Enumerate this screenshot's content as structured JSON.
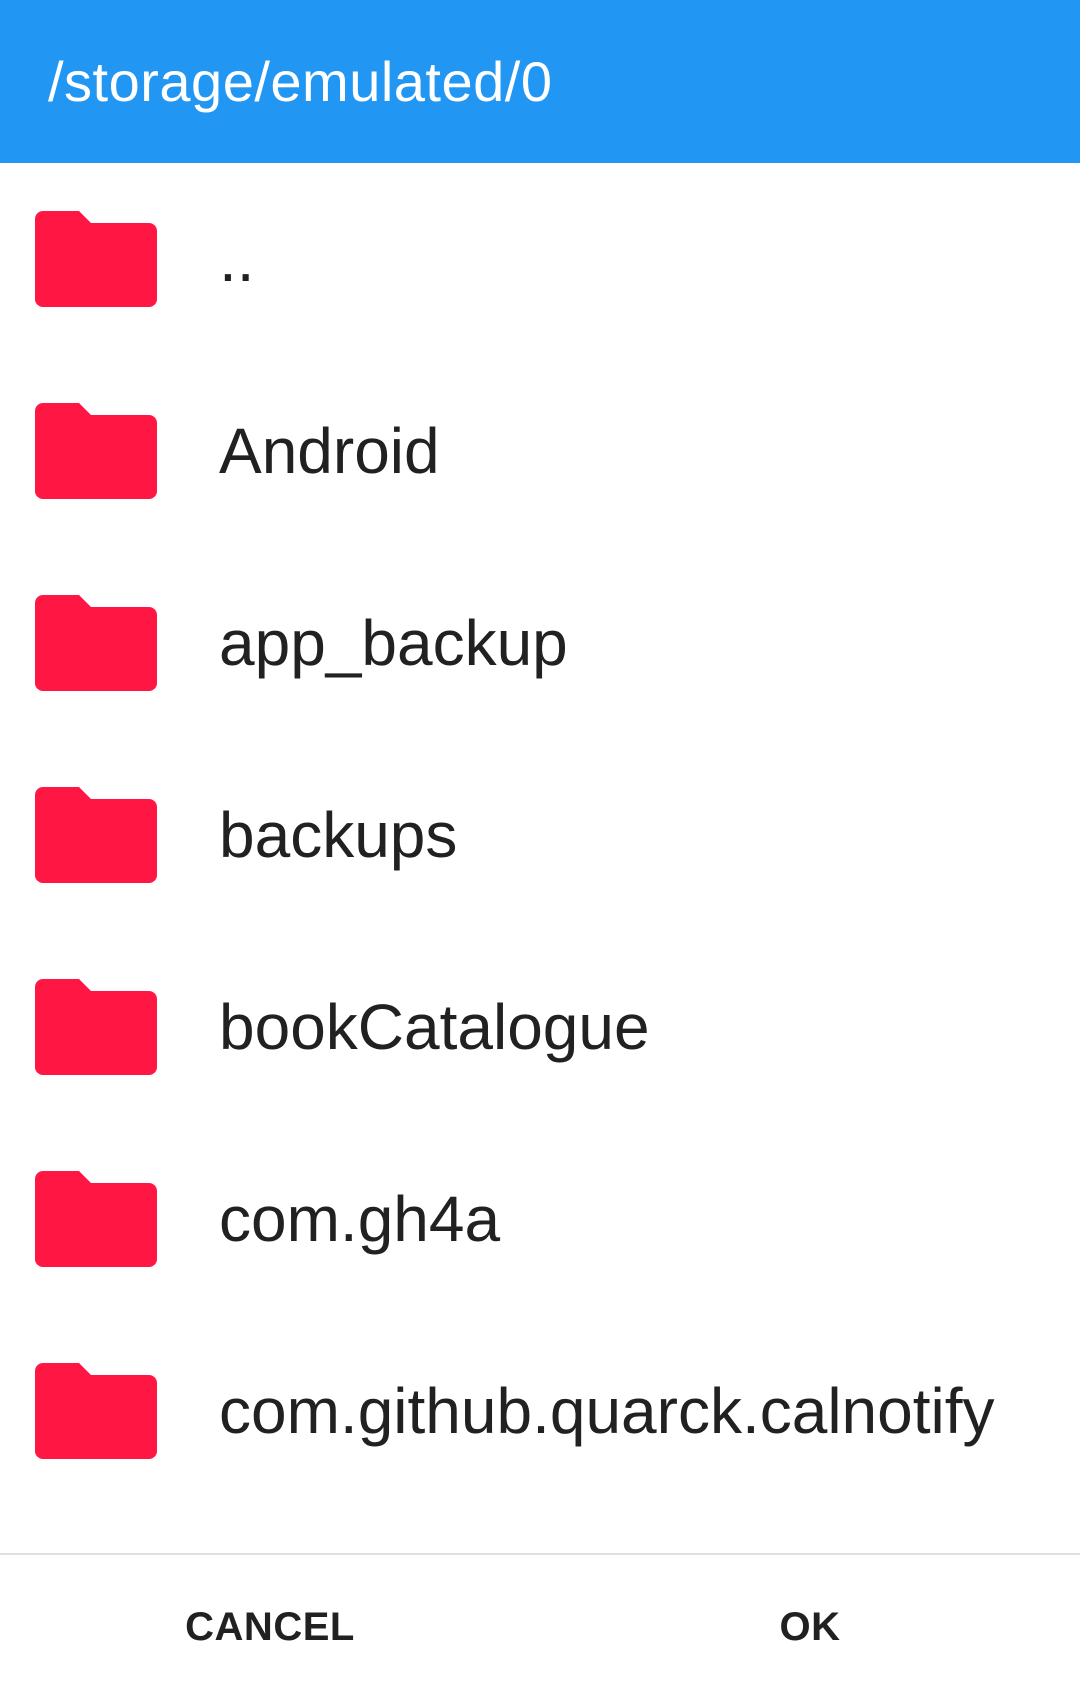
{
  "header": {
    "title": "/storage/emulated/0"
  },
  "colors": {
    "header_bg": "#2196f3",
    "folder": "#ff1744",
    "text": "#212121"
  },
  "list": {
    "items": [
      {
        "label": "..",
        "icon": "folder-icon"
      },
      {
        "label": "Android",
        "icon": "folder-icon"
      },
      {
        "label": "app_backup",
        "icon": "folder-icon"
      },
      {
        "label": "backups",
        "icon": "folder-icon"
      },
      {
        "label": "bookCatalogue",
        "icon": "folder-icon"
      },
      {
        "label": "com.gh4a",
        "icon": "folder-icon"
      },
      {
        "label": "com.github.quarck.calnotify",
        "icon": "folder-icon"
      }
    ]
  },
  "actions": {
    "cancel_label": "CANCEL",
    "ok_label": "OK"
  }
}
